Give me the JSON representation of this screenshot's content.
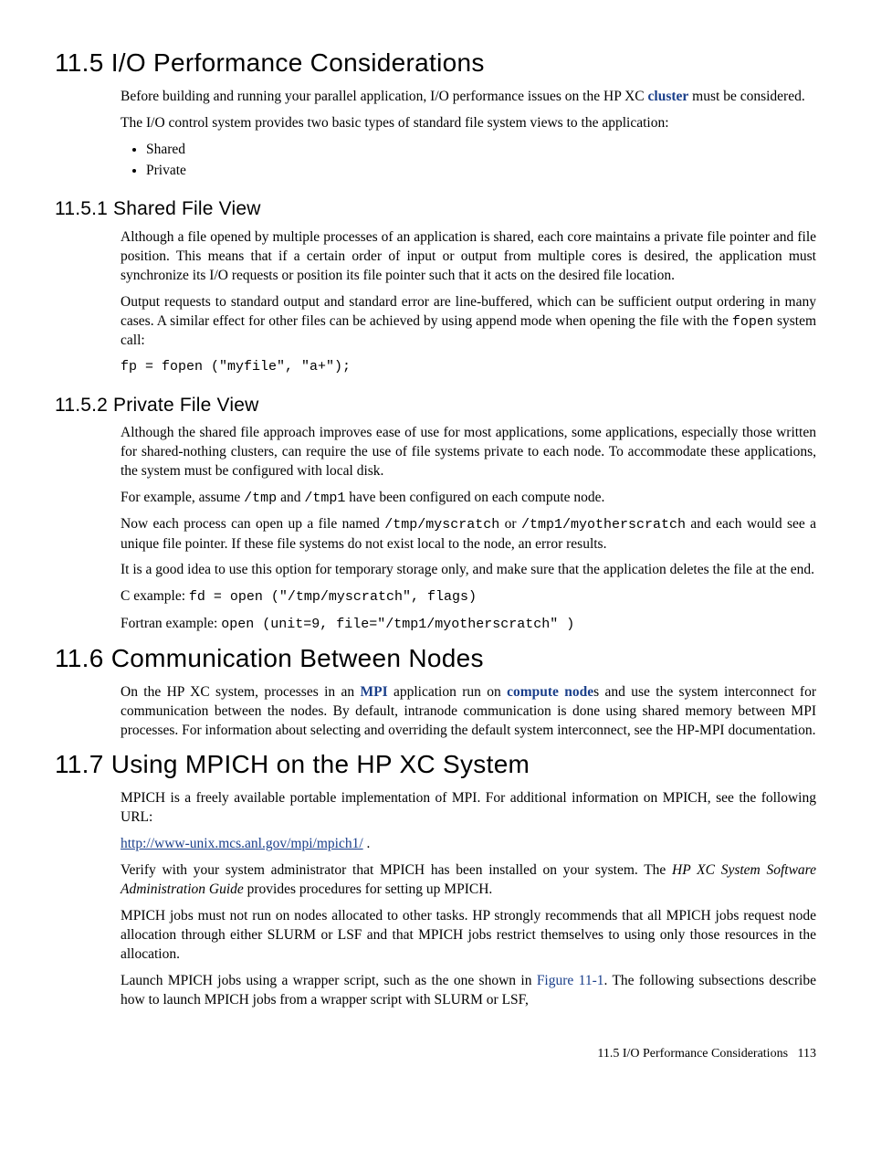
{
  "s115": {
    "heading": "11.5 I/O Performance Considerations",
    "p1a": "Before building and running your parallel application, I/O performance issues on the HP XC ",
    "p1_link": "cluster",
    "p1b": " must be considered.",
    "p2": "The I/O control system provides two basic types of standard file system views to the application:",
    "bul1": "Shared",
    "bul2": "Private"
  },
  "s1151": {
    "heading": "11.5.1 Shared File View",
    "p1": "Although a file opened by multiple processes of an application is shared, each core maintains a private file pointer and file position. This means that if a certain order of input or output from multiple cores is desired, the application must synchronize its I/O requests or position its file pointer such that it acts on the desired file location.",
    "p2a": "Output requests to standard output and standard error are line-buffered, which can be sufficient output ordering in many cases. A similar effect for other files can be achieved by using append mode when opening the file with the ",
    "p2code": "fopen",
    "p2b": " system call:",
    "code": "fp = fopen (\"myfile\", \"a+\");"
  },
  "s1152": {
    "heading": "11.5.2 Private File View",
    "p1": "Although the shared file approach improves ease of use for most applications, some applications, especially those written for shared-nothing clusters, can require the use of file systems private to each node. To accommodate these applications, the system must be configured with local disk.",
    "p2a": "For example, assume ",
    "p2c1": "/tmp",
    "p2b": " and ",
    "p2c2": "/tmp1",
    "p2c": " have been configured on each compute node.",
    "p3a": "Now each process can open up a file named ",
    "p3c1": "/tmp/myscratch",
    "p3b": " or ",
    "p3c2": "/tmp1/myotherscratch",
    "p3c": " and each would see a unique file pointer. If these file systems do not exist local to the node, an error results.",
    "p4": "It is a good idea to use this option for temporary storage only, and make sure that the application deletes the file at the end.",
    "p5a": "C example: ",
    "p5c": "fd = open (\"/tmp/myscratch\", flags)",
    "p6a": "Fortran example: ",
    "p6c": "open (unit=9, file=\"/tmp1/myotherscratch\" )"
  },
  "s116": {
    "heading": "11.6 Communication Between Nodes",
    "p1a": "On the HP XC system, processes in an ",
    "p1l1": "MPI",
    "p1b": " application run on ",
    "p1l2": "compute node",
    "p1c": "s and use the system interconnect for communication between the nodes. By default, intranode communication is done using shared memory between MPI processes. For information about selecting and overriding the default system interconnect, see the HP-MPI documentation."
  },
  "s117": {
    "heading": "11.7 Using MPICH on the HP XC System",
    "p1": "MPICH is a freely available portable implementation of MPI. For additional information on MPICH, see the following URL:",
    "url": "http://www-unix.mcs.anl.gov/mpi/mpich1/",
    "p2a": "Verify with your system administrator that MPICH has been installed on your system. The ",
    "p2i": "HP XC System Software Administration Guide",
    "p2b": " provides procedures for setting up MPICH.",
    "p3": "MPICH jobs must not run on nodes allocated to other tasks. HP strongly recommends that all MPICH jobs request node allocation through either SLURM or LSF and that MPICH jobs restrict themselves to using only those resources in the allocation.",
    "p4a": "Launch MPICH jobs using a wrapper script, such as the one shown in ",
    "p4l": "Figure 11-1",
    "p4b": ". The following subsections describe how to launch MPICH jobs from a wrapper script with SLURM or LSF,"
  },
  "footer": {
    "text": "11.5 I/O Performance Considerations",
    "page": "113"
  }
}
